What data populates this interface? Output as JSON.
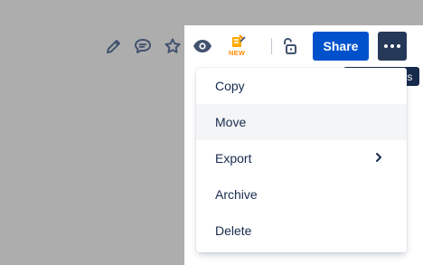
{
  "toolbar": {
    "share_label": "Share",
    "icons": [
      "pencil-icon",
      "comment-icon",
      "star-icon",
      "eye-icon",
      "new-feature-icon",
      "unlock-icon",
      "more-icon"
    ],
    "new_badge": "NEW"
  },
  "tooltip": {
    "text": "More actions"
  },
  "menu": {
    "items": [
      {
        "label": "Copy"
      },
      {
        "label": "Move"
      },
      {
        "label": "Export"
      },
      {
        "label": "Archive"
      },
      {
        "label": "Delete"
      }
    ]
  },
  "colors": {
    "share": "#0052cc",
    "more_button": "#253858",
    "tooltip": "#172b4d",
    "hover": "#f4f5f7",
    "backdrop": "#adadad"
  }
}
